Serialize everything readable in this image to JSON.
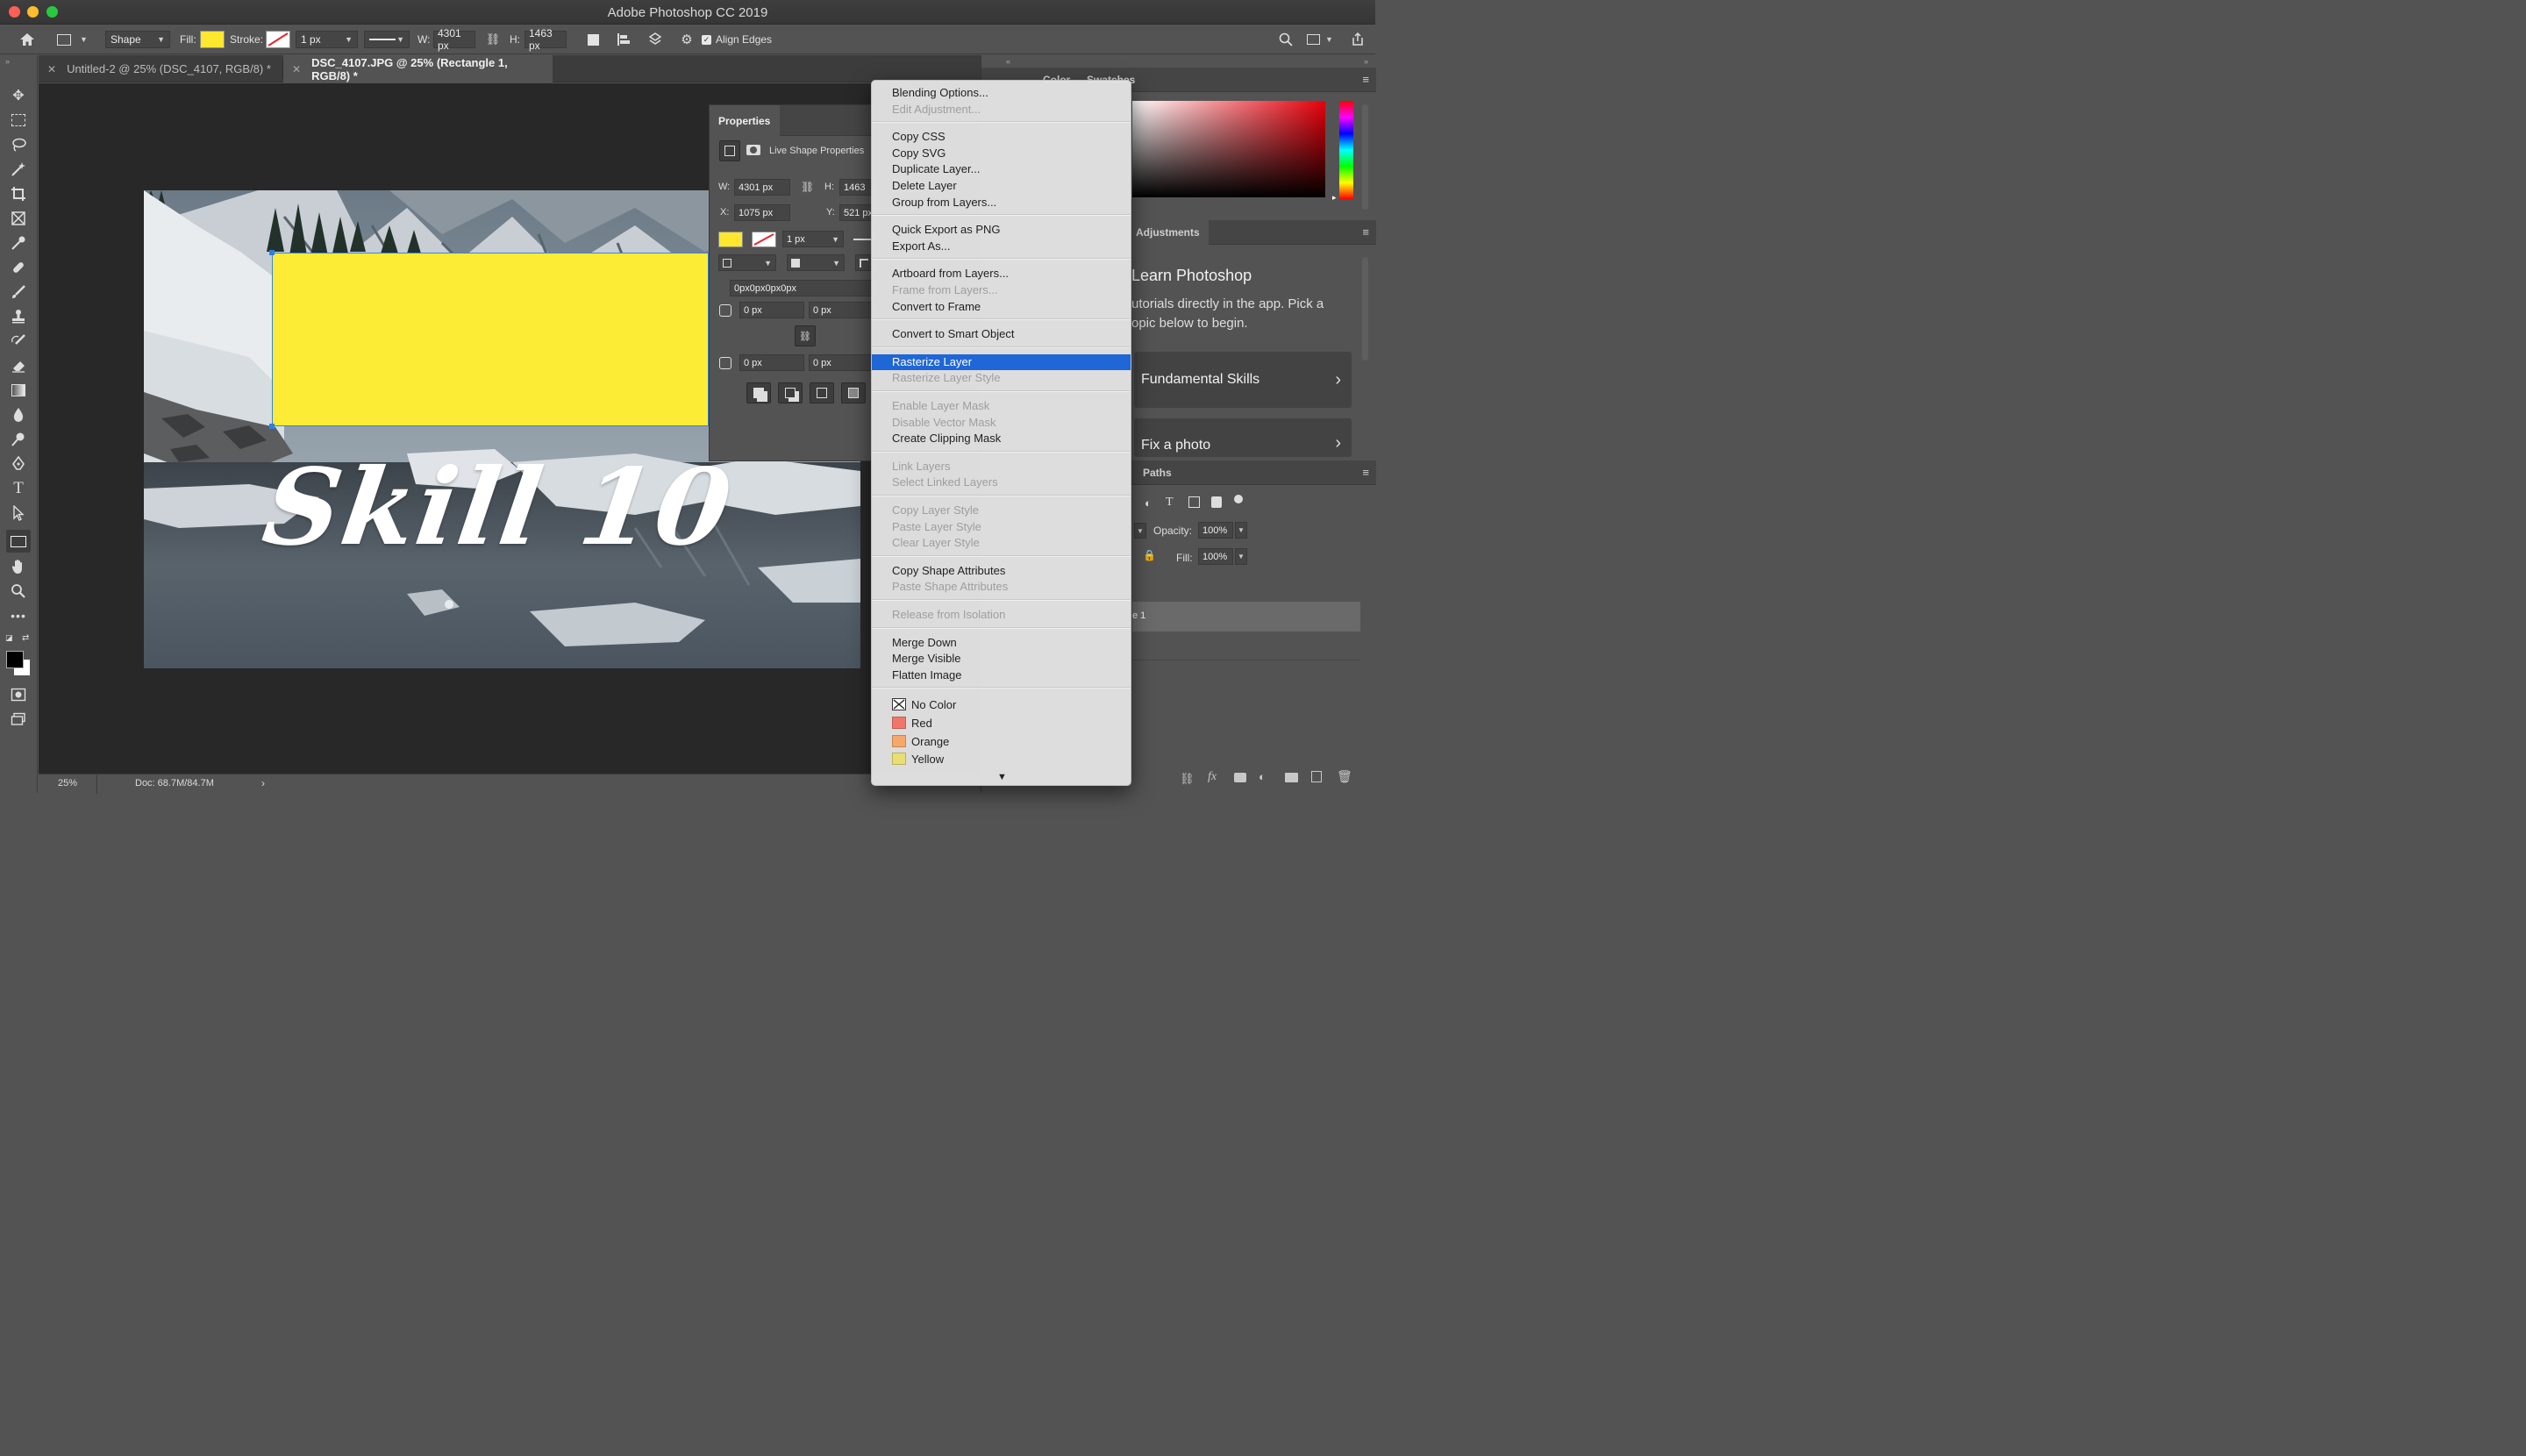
{
  "window": {
    "title": "Adobe Photoshop CC 2019"
  },
  "options_bar": {
    "tool_mode": "Shape",
    "fill_label": "Fill:",
    "stroke_label": "Stroke:",
    "stroke_width": "1 px",
    "w_label": "W:",
    "w_value": "4301 px",
    "h_label": "H:",
    "h_value": "1463 px",
    "align_edges_label": "Align Edges",
    "fill_color": "#fde72f"
  },
  "tabs": [
    {
      "label": "Untitled-2 @ 25% (DSC_4107, RGB/8) *"
    },
    {
      "label": "DSC_4107.JPG @ 25% (Rectangle 1, RGB/8) *"
    }
  ],
  "canvas": {
    "text_overlay": "Skill 10",
    "rect_fill": "#fdec35"
  },
  "status_bar": {
    "zoom": "25%",
    "doc": "Doc: 68.7M/84.7M"
  },
  "properties": {
    "tab": "Properties",
    "subtitle": "Live Shape Properties",
    "w_label": "W:",
    "w_value": "4301 px",
    "h_label": "H:",
    "h_value": "1463",
    "x_label": "X:",
    "x_value": "1075 px",
    "y_label": "Y:",
    "y_value": "521 px",
    "stroke_width": "1 px",
    "corner_all": "0px0px0px0px",
    "corner_tl": "0 px",
    "corner_tr": "0 px",
    "corner_bl": "0 px",
    "corner_br": "0 px"
  },
  "right_panels": {
    "color_tabs": [
      "Color",
      "Swatches"
    ],
    "adjustments_tab": "Adjustments",
    "learn_title": "Learn Photoshop",
    "learn_desc_1": "utorials directly in the app. Pick a",
    "learn_desc_2": "opic below to begin.",
    "card_1": "Fundamental Skills",
    "card_2": "Fix a photo",
    "paths_tab": "Paths",
    "opacity_label": "Opacity:",
    "opacity_value": "100%",
    "fill_label": "Fill:",
    "fill_value": "100%",
    "layer_partial": "e 1"
  },
  "context_menu": {
    "groups": [
      [
        {
          "label": "Blending Options...",
          "enabled": true
        },
        {
          "label": "Edit Adjustment...",
          "enabled": false
        }
      ],
      [
        {
          "label": "Copy CSS",
          "enabled": true
        },
        {
          "label": "Copy SVG",
          "enabled": true
        },
        {
          "label": "Duplicate Layer...",
          "enabled": true
        },
        {
          "label": "Delete Layer",
          "enabled": true
        },
        {
          "label": "Group from Layers...",
          "enabled": true
        }
      ],
      [
        {
          "label": "Quick Export as PNG",
          "enabled": true
        },
        {
          "label": "Export As...",
          "enabled": true
        }
      ],
      [
        {
          "label": "Artboard from Layers...",
          "enabled": true
        },
        {
          "label": "Frame from Layers...",
          "enabled": false
        },
        {
          "label": "Convert to Frame",
          "enabled": true
        }
      ],
      [
        {
          "label": "Convert to Smart Object",
          "enabled": true
        }
      ],
      [
        {
          "label": "Rasterize Layer",
          "enabled": true,
          "highlighted": true
        },
        {
          "label": "Rasterize Layer Style",
          "enabled": false
        }
      ],
      [
        {
          "label": "Enable Layer Mask",
          "enabled": false
        },
        {
          "label": "Disable Vector Mask",
          "enabled": false
        },
        {
          "label": "Create Clipping Mask",
          "enabled": true
        }
      ],
      [
        {
          "label": "Link Layers",
          "enabled": false
        },
        {
          "label": "Select Linked Layers",
          "enabled": false
        }
      ],
      [
        {
          "label": "Copy Layer Style",
          "enabled": false
        },
        {
          "label": "Paste Layer Style",
          "enabled": false
        },
        {
          "label": "Clear Layer Style",
          "enabled": false
        }
      ],
      [
        {
          "label": "Copy Shape Attributes",
          "enabled": true
        },
        {
          "label": "Paste Shape Attributes",
          "enabled": false
        }
      ],
      [
        {
          "label": "Release from Isolation",
          "enabled": false
        }
      ],
      [
        {
          "label": "Merge Down",
          "enabled": true
        },
        {
          "label": "Merge Visible",
          "enabled": true
        },
        {
          "label": "Flatten Image",
          "enabled": true
        }
      ]
    ],
    "colors": [
      {
        "label": "No Color",
        "swatch": "none"
      },
      {
        "label": "Red",
        "swatch": "#f0766b"
      },
      {
        "label": "Orange",
        "swatch": "#f4a96a"
      },
      {
        "label": "Yellow",
        "swatch": "#e9de74"
      }
    ],
    "more_indicator": "▼"
  }
}
